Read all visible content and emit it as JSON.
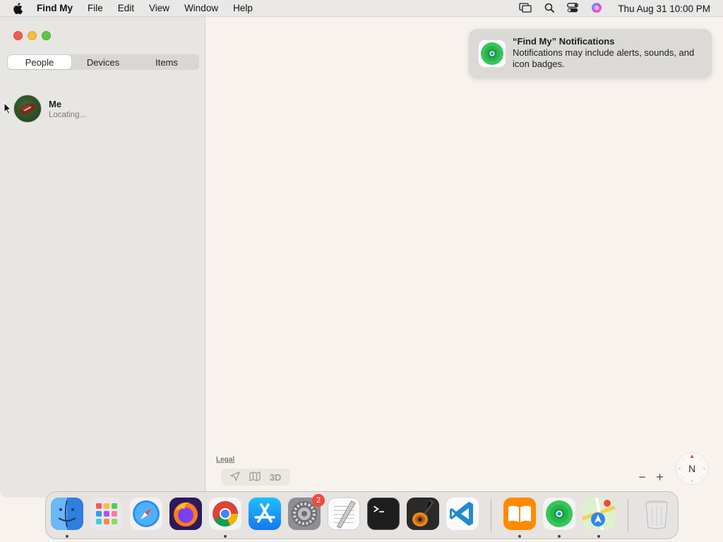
{
  "menubar": {
    "app_name": "Find My",
    "menus": [
      "File",
      "Edit",
      "View",
      "Window",
      "Help"
    ],
    "clock": "Thu Aug 31  10:00 PM",
    "status_icons": [
      "screen-mirroring-icon",
      "spotlight-search-icon",
      "control-center-icon",
      "siri-icon"
    ]
  },
  "sidebar": {
    "tabs": [
      {
        "label": "People",
        "active": true
      },
      {
        "label": "Devices",
        "active": false
      },
      {
        "label": "Items",
        "active": false
      }
    ],
    "people": [
      {
        "name": "Me",
        "status": "Locating..."
      }
    ]
  },
  "map": {
    "legal_label": "Legal",
    "view_3d_label": "3D",
    "zoom_out_label": "−",
    "zoom_in_label": "+",
    "compass_label": "N"
  },
  "notification": {
    "title": "“Find My” Notifications",
    "body": "Notifications may include alerts, sounds, and icon badges."
  },
  "dock": {
    "apps": [
      "Finder",
      "Launchpad",
      "Safari",
      "Firefox",
      "Google Chrome",
      "App Store",
      "System Settings",
      "TextEdit",
      "Terminal",
      "GarageBand",
      "Visual Studio Code",
      "Books",
      "Find My",
      "Maps",
      "Trash"
    ],
    "system_settings_badge": "2"
  },
  "colors": {
    "close": "#ee5d56",
    "minimize": "#f4bd3b",
    "maximize": "#5fc649",
    "findmy_green": "#34c759",
    "badge_red": "#f04a3c"
  }
}
